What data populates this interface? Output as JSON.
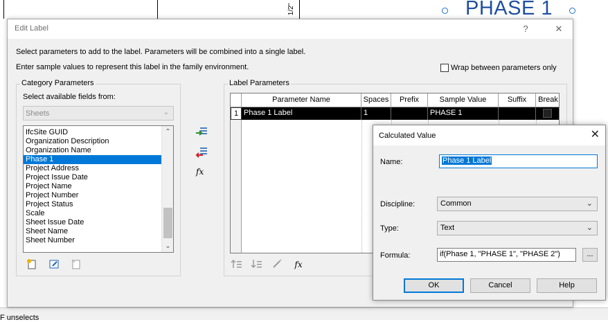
{
  "background": {
    "dimension_label": "1/2\"",
    "phase_heading": "PHASE 1",
    "status_text": "F unselects"
  },
  "edit_label": {
    "title": "Edit Label",
    "help_button": "?",
    "close_button": "✕",
    "intro_line1": "Select parameters to add to the label.  Parameters will be combined into a single label.",
    "intro_line2": "Enter sample values to represent this label in the family environment.",
    "wrap_label": "Wrap between parameters only",
    "wrap_checked": false,
    "category": {
      "group_title": "Category Parameters",
      "fields_label": "Select available fields from:",
      "source_value": "Sheets",
      "items": [
        "IfcSite GUID",
        "Organization Description",
        "Organization Name",
        "Phase 1",
        "Project Address",
        "Project Issue Date",
        "Project Name",
        "Project Number",
        "Project Status",
        "Scale",
        "Sheet Issue Date",
        "Sheet Name",
        "Sheet Number"
      ],
      "selected_item": "Phase 1"
    },
    "label_params": {
      "group_title": "Label Parameters",
      "columns": [
        "Parameter Name",
        "Spaces",
        "Prefix",
        "Sample Value",
        "Suffix",
        "Break"
      ],
      "rows": [
        {
          "index": "1",
          "parameter_name": "Phase 1 Label",
          "spaces": "1",
          "prefix": "",
          "sample_value": "PHASE 1",
          "suffix": ""
        }
      ]
    },
    "fx_symbol": "fx",
    "fx_edit_symbol": "fx"
  },
  "calculated_value": {
    "title": "Calculated Value",
    "close_button": "✕",
    "name_label": "Name:",
    "name_value": "Phase 1 Label",
    "discipline_label": "Discipline:",
    "discipline_value": "Common",
    "type_label": "Type:",
    "type_value": "Text",
    "formula_label": "Formula:",
    "formula_value": "if(Phase 1, \"PHASE 1\", \"PHASE 2\")",
    "ellipsis_button": "...",
    "ok_button": "OK",
    "cancel_button": "Cancel",
    "help_button": "Help"
  },
  "colors": {
    "accent": "#0078d7",
    "phase_heading": "#1f4fa0",
    "dialog_bg": "#f0f0f0"
  }
}
